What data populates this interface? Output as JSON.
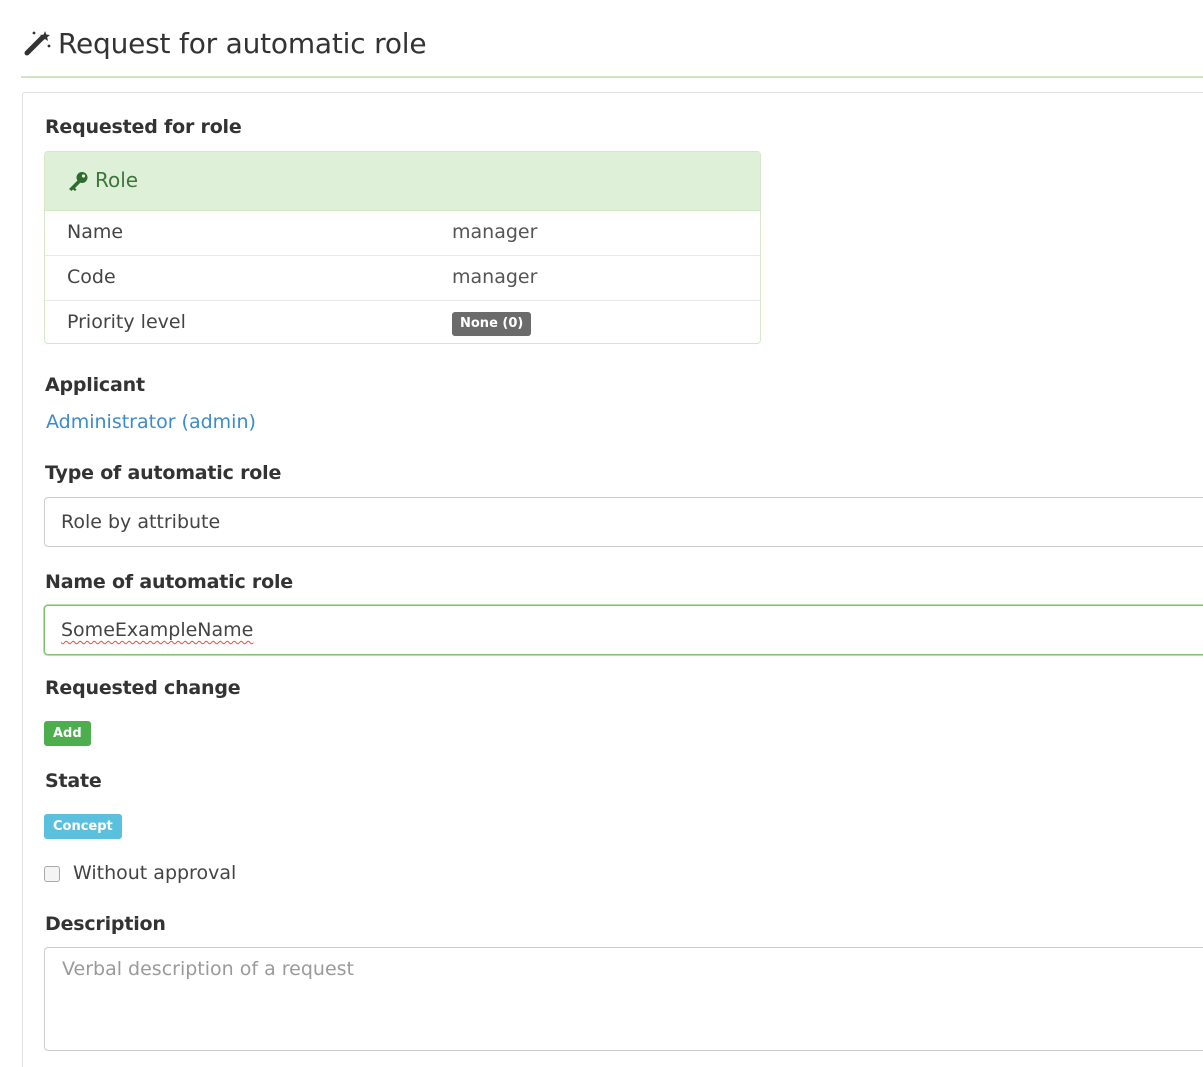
{
  "header": {
    "title": "Request for automatic role",
    "icon": "magic-wand-icon"
  },
  "requested_role": {
    "label": "Requested for role",
    "panel_title": "Role",
    "panel_icon": "key-icon",
    "rows": [
      {
        "key": "Name",
        "value": "manager"
      },
      {
        "key": "Code",
        "value": "manager"
      },
      {
        "key": "Priority level",
        "value": "None (0)"
      }
    ]
  },
  "applicant": {
    "label": "Applicant",
    "value": "Administrator (admin)"
  },
  "type": {
    "label": "Type of automatic role",
    "value": "Role by attribute"
  },
  "name": {
    "label": "Name of automatic role",
    "value": "SomeExampleName"
  },
  "requested_change": {
    "label": "Requested change",
    "value": "Add"
  },
  "state": {
    "label": "State",
    "value": "Concept"
  },
  "without_approval": {
    "label": "Without approval",
    "checked": false
  },
  "description": {
    "label": "Description",
    "placeholder": "Verbal description of a request"
  },
  "colors": {
    "success_header": "#dff0d8",
    "success_text": "#3c763d",
    "link": "#3b8bcf",
    "add_badge": "#4cae4c",
    "concept_badge": "#5bc0de",
    "none_badge": "#6b6b6b"
  }
}
